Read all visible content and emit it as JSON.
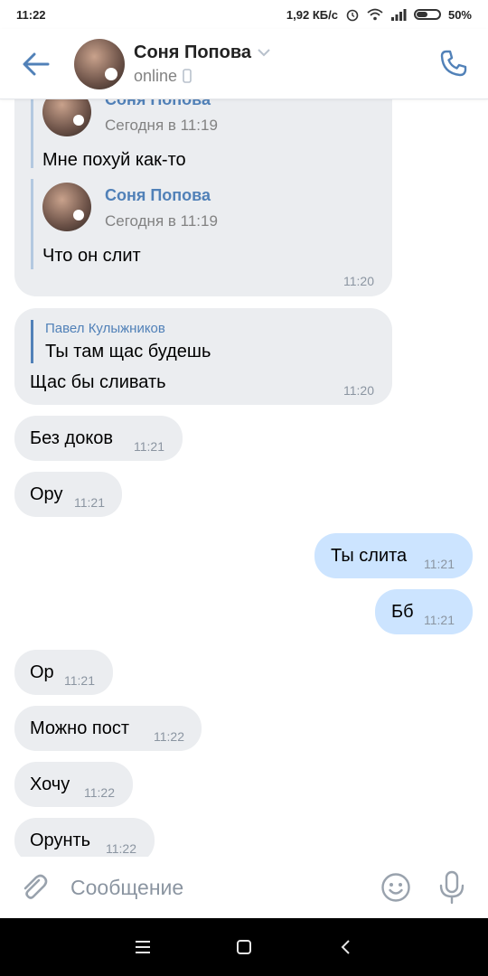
{
  "status_bar": {
    "time": "11:22",
    "speed": "1,92 КБ/с",
    "battery": "50%",
    "battery_level": 0.5
  },
  "header": {
    "name": "Соня Попова",
    "status": "online"
  },
  "messages": {
    "m1": {
      "fwd1_name": "Соня Попова",
      "fwd1_date": "Сегодня в 11:19",
      "fwd1_text": "Мне похуй как-то",
      "fwd2_name": "Соня Попова",
      "fwd2_date": "Сегодня в 11:19",
      "fwd2_text": "Что он слит",
      "time": "11:20"
    },
    "m2": {
      "reply_name": "Павел Кулыжников",
      "reply_text": "Ты там щас будешь",
      "text": "Щас бы сливать",
      "time": "11:20"
    },
    "m3": {
      "text": "Без доков",
      "time": "11:21"
    },
    "m4": {
      "text": "Ору",
      "time": "11:21"
    },
    "m5": {
      "text": "Ты слита",
      "time": "11:21"
    },
    "m6": {
      "text": "Бб",
      "time": "11:21"
    },
    "m7": {
      "text": "Ор",
      "time": "11:21"
    },
    "m8": {
      "text": "Можно пост",
      "time": "11:22"
    },
    "m9": {
      "text": "Хочу",
      "time": "11:22"
    },
    "m10": {
      "text": "Орунть",
      "time": "11:22"
    }
  },
  "input": {
    "placeholder": "Сообщение",
    "value": ""
  },
  "icons": {
    "back": "back-arrow-icon",
    "phone": "phone-icon",
    "attach": "paperclip-icon",
    "emoji": "smile-icon",
    "mic": "microphone-icon",
    "nav_menu": "menu-icon",
    "nav_home": "home-icon",
    "nav_back": "nav-back-icon"
  },
  "colors": {
    "accent": "#5181b8",
    "incoming_bubble": "#ebedf0",
    "outgoing_bubble": "#cce4ff"
  }
}
